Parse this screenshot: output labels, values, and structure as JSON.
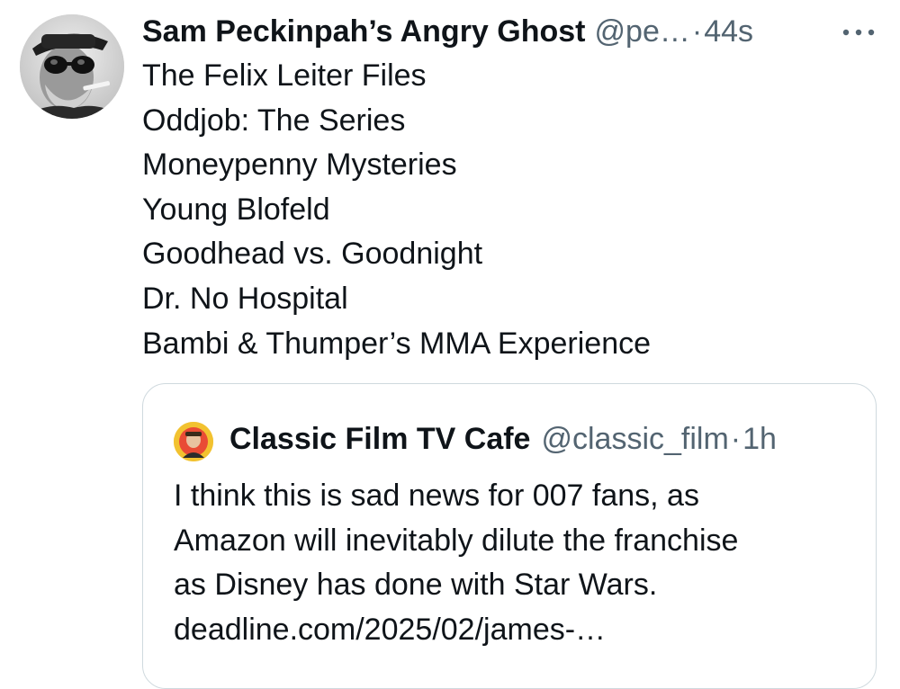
{
  "tweet": {
    "author": {
      "display_name": "Sam Peckinpah’s Angry Ghost",
      "handle": "@pe…",
      "separator": "·",
      "time": "44s"
    },
    "lines": [
      "The Felix Leiter Files",
      "Oddjob: The Series",
      "Moneypenny Mysteries",
      "Young Blofeld",
      "Goodhead vs. Goodnight",
      "Dr. No Hospital",
      "Bambi & Thumper’s MMA Experience"
    ],
    "more_icon": "more-horizontal-icon"
  },
  "quote": {
    "author": {
      "display_name": "Classic Film TV Cafe",
      "handle": "@classic_film",
      "separator": "·",
      "time": "1h"
    },
    "lines": [
      "I think this is sad news for 007 fans, as",
      "Amazon will inevitably dilute the franchise",
      "as Disney has done with Star Wars.",
      "deadline.com/2025/02/james-…"
    ]
  },
  "colors": {
    "text_primary": "#0f1419",
    "text_secondary": "#536471",
    "border": "#cfd9de",
    "quote_avatar_bg": "#f2c230"
  }
}
